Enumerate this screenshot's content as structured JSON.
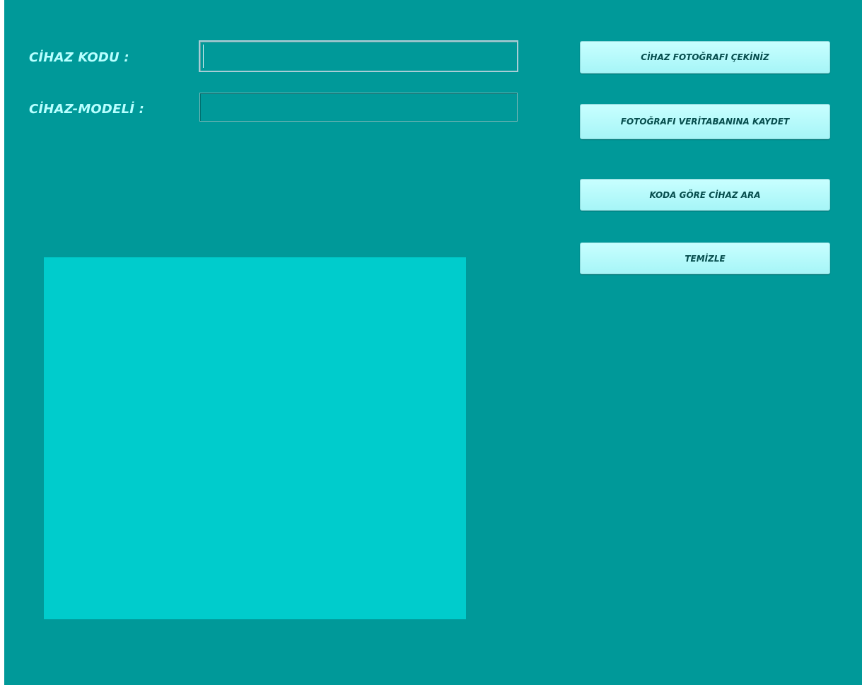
{
  "form": {
    "code_label": "CİHAZ KODU :",
    "model_label": "CİHAZ-MODELİ :",
    "code_value": "",
    "model_value": ""
  },
  "buttons": {
    "take_photo": "CİHAZ FOTOĞRAFI ÇEKİNİZ",
    "save_photo": "FOTOĞRAFI VERİTABANINA KAYDET",
    "search_by_code": "KODA GÖRE CİHAZ ARA",
    "clear": "TEMİZLE"
  },
  "colors": {
    "background": "#009999",
    "label_text": "#b8ffff",
    "button_face": "#b3fbfd",
    "button_text": "#064d4d",
    "picture_box": "#00cccc"
  }
}
